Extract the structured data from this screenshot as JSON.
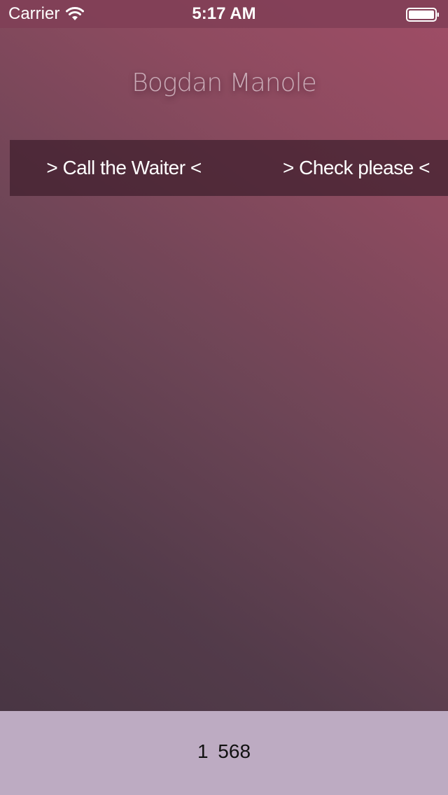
{
  "status_bar": {
    "carrier": "Carrier",
    "time": "5:17 AM",
    "wifi_icon": "wifi-icon",
    "battery_icon": "battery-full-icon"
  },
  "header": {
    "title": "Bogdan Manole"
  },
  "actions": {
    "call_waiter_label": "> Call the Waiter <",
    "check_please_label": "> Check please <"
  },
  "footer": {
    "number": "1 568"
  },
  "colors": {
    "gradient_top": "#a04d66",
    "gradient_bottom": "#453441",
    "status_bar": "#803e56",
    "action_bar": "#3e1e2c",
    "title_text": "#c9aab6",
    "footer_bg": "#bdabc2"
  }
}
